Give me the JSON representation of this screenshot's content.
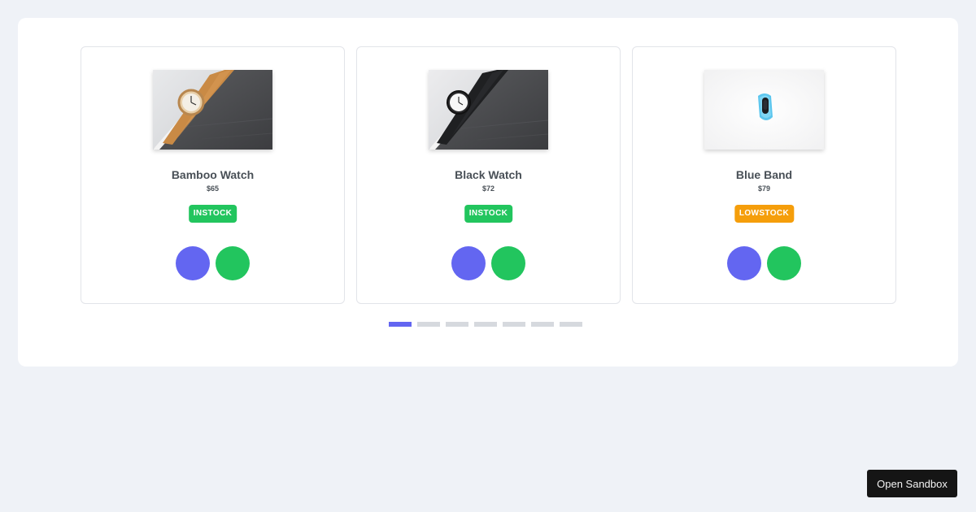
{
  "colors": {
    "primary": "#6366f1",
    "success": "#22c55e",
    "warning": "#f59e0b",
    "dot_inactive": "#d6d9de"
  },
  "products": [
    {
      "name": "Bamboo Watch",
      "price": "$65",
      "status": "INSTOCK",
      "status_color": "#22c55e",
      "image": "bamboo-watch-image"
    },
    {
      "name": "Black Watch",
      "price": "$72",
      "status": "INSTOCK",
      "status_color": "#22c55e",
      "image": "black-watch-image"
    },
    {
      "name": "Blue Band",
      "price": "$79",
      "status": "LOWSTOCK",
      "status_color": "#f59e0b",
      "image": "blue-band-image"
    }
  ],
  "actions": [
    {
      "icon": "search-icon",
      "color": "#6366f1"
    },
    {
      "icon": "star-icon",
      "color": "#22c55e"
    }
  ],
  "pagination": {
    "page_count": 7,
    "active_index": 0
  },
  "sandbox": {
    "label": "Open Sandbox"
  }
}
